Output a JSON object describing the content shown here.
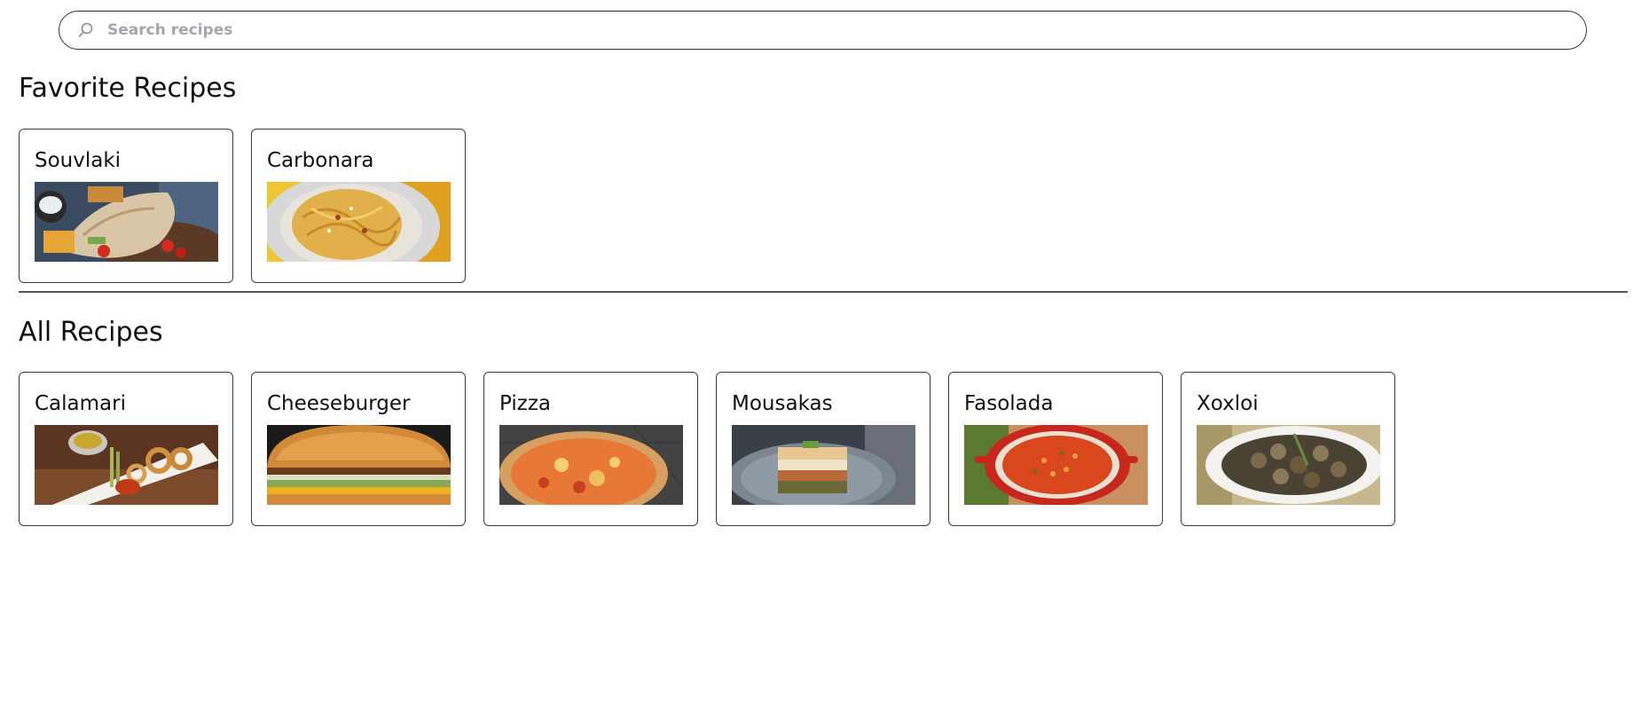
{
  "search": {
    "placeholder": "Search recipes"
  },
  "favorites": {
    "title": "Favorite Recipes",
    "items": [
      {
        "name": "Souvlaki",
        "image": "souvlaki-wrap-photo"
      },
      {
        "name": "Carbonara",
        "image": "carbonara-spaghetti-photo"
      }
    ]
  },
  "all": {
    "title": "All Recipes",
    "items": [
      {
        "name": "Calamari",
        "image": "fried-calamari-photo"
      },
      {
        "name": "Cheeseburger",
        "image": "cheeseburger-photo"
      },
      {
        "name": "Pizza",
        "image": "cheese-pizza-photo"
      },
      {
        "name": "Mousakas",
        "image": "moussaka-slice-photo"
      },
      {
        "name": "Fasolada",
        "image": "bean-soup-pot-photo"
      },
      {
        "name": "Xoxloi",
        "image": "snails-dish-photo"
      }
    ]
  },
  "colors": {
    "border": "#3a3a4e",
    "placeholder": "#a4a4ae",
    "divider": "#555555"
  }
}
